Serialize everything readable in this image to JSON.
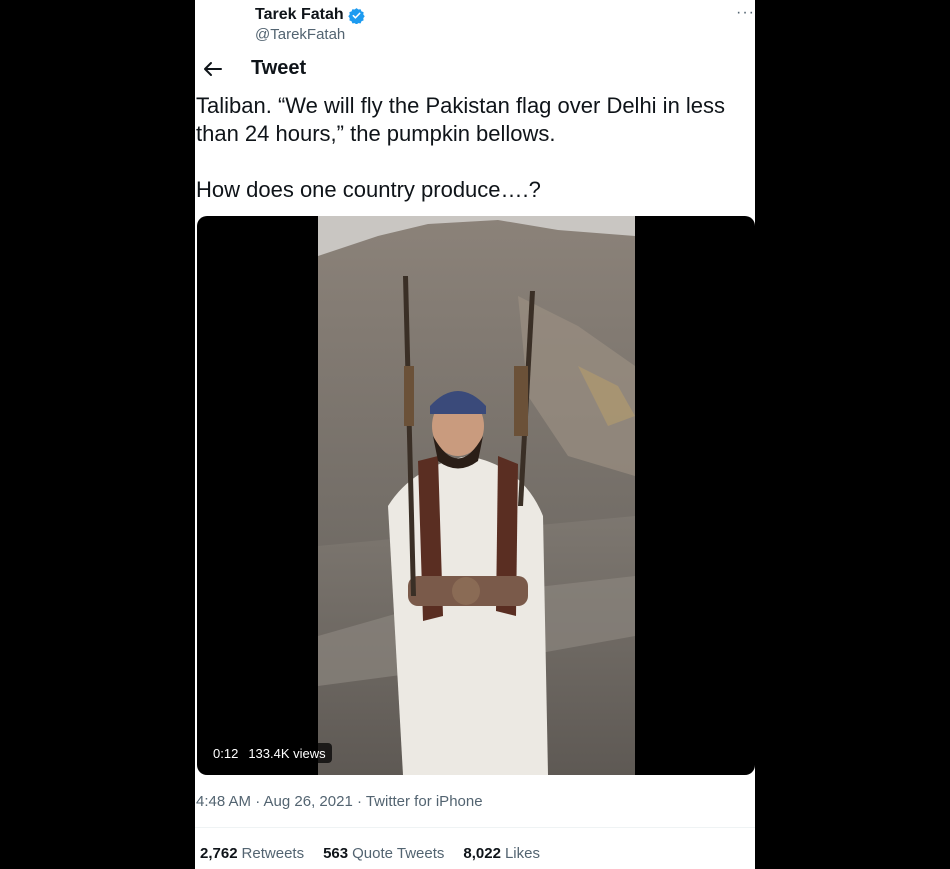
{
  "tweet": {
    "author": {
      "name": "Tarek Fatah",
      "handle": "@TarekFatah",
      "verified_color": "#1d9bf0"
    },
    "more_icon": "···",
    "header_title": "Tweet",
    "text": "Taliban.  “We will fly the Pakistan flag over Delhi in less than 24 hours,” the pumpkin bellows.\n\nHow does one country produce….?",
    "media": {
      "duration": "0:12",
      "views": "133.4K views"
    },
    "meta": "4:48 AM · Aug 26, 2021 · Twitter for iPhone",
    "stats": {
      "retweets": {
        "count": "2,762",
        "label": "Retweets"
      },
      "quotes": {
        "count": "563",
        "label": "Quote Tweets"
      },
      "likes": {
        "count": "8,022",
        "label": "Likes"
      }
    }
  }
}
